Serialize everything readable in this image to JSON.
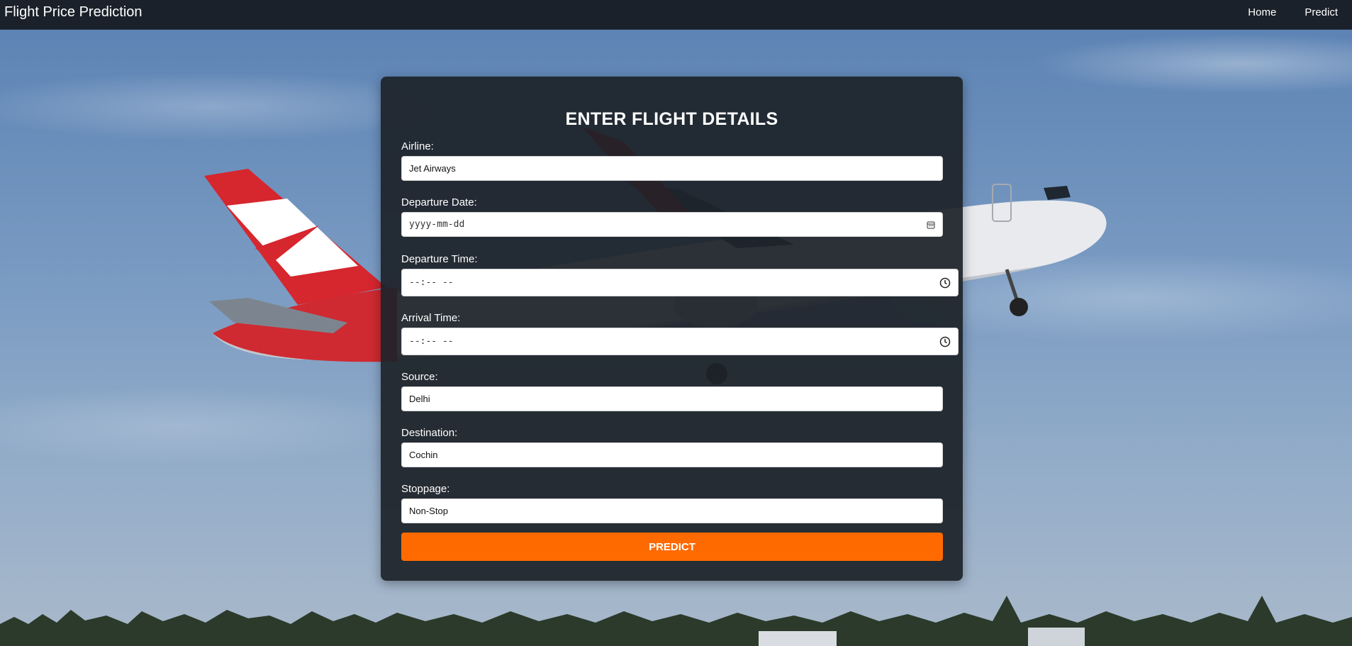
{
  "navbar": {
    "brand": "Flight Price Prediction",
    "links": [
      "Home",
      "Predict"
    ]
  },
  "form": {
    "title": "ENTER FLIGHT DETAILS",
    "fields": [
      {
        "label": "Airline:",
        "value": "Jet Airways",
        "type": "select"
      },
      {
        "label": "Departure Date:",
        "placeholder": "yyyy-mm-dd",
        "type": "date",
        "icon": "calendar-icon"
      },
      {
        "label": "Departure Time:",
        "placeholder": "--:-- --",
        "type": "time",
        "icon": "clock-icon"
      },
      {
        "label": "Arrival Time:",
        "placeholder": "--:-- --",
        "type": "time",
        "icon": "clock-icon"
      },
      {
        "label": "Source:",
        "value": "Delhi",
        "type": "select"
      },
      {
        "label": "Destination:",
        "value": "Cochin",
        "type": "select"
      },
      {
        "label": "Stoppage:",
        "value": "Non-Stop",
        "type": "select"
      }
    ],
    "submit_label": "PREDICT"
  },
  "colors": {
    "navbar_bg": "#1b212a",
    "card_bg": "#1d2229",
    "accent": "#ff6a00",
    "text": "#ffffff"
  }
}
